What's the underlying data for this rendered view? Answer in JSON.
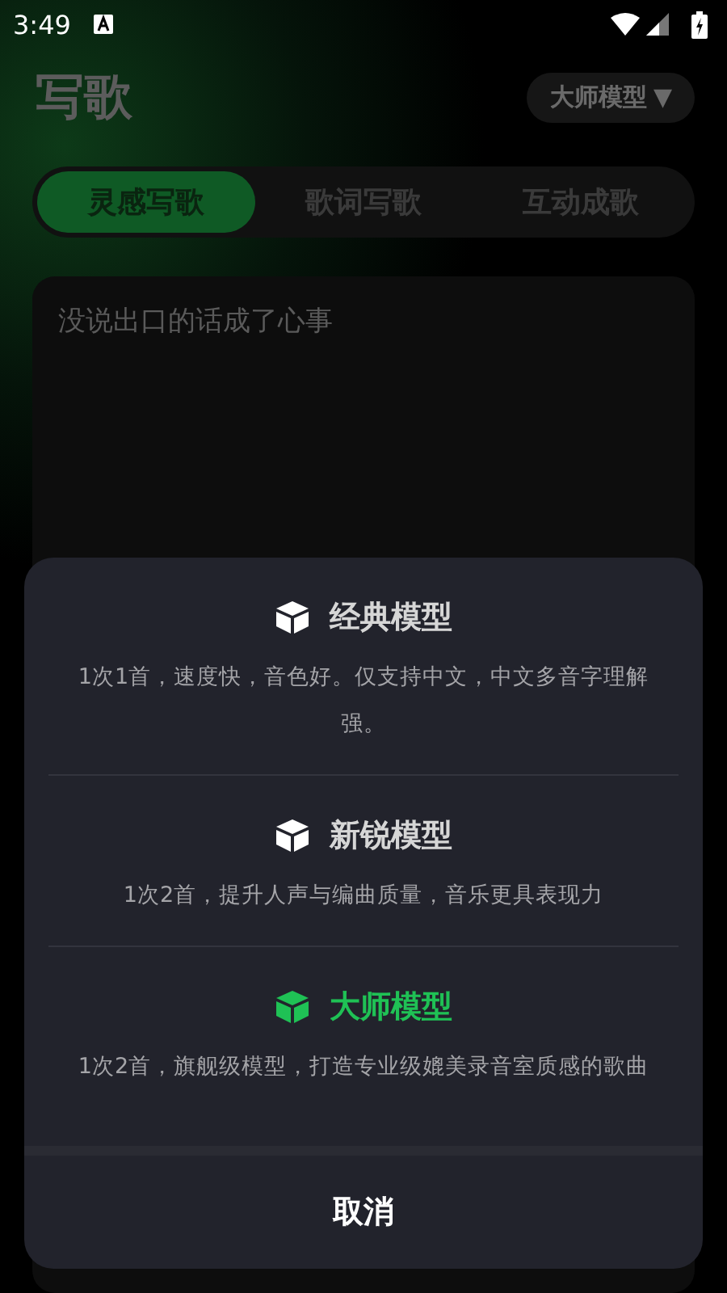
{
  "status_bar": {
    "time": "3:49"
  },
  "header": {
    "title": "写歌",
    "model_picker": {
      "label": "大师模型",
      "caret": "▼"
    }
  },
  "tabs": [
    {
      "label": "灵感写歌",
      "selected": true
    },
    {
      "label": "歌词写歌",
      "selected": false
    },
    {
      "label": "互动成歌",
      "selected": false
    }
  ],
  "prompt": {
    "value": "没说出口的话成了心事"
  },
  "model_sheet": {
    "options": [
      {
        "title": "经典模型",
        "description": "1次1首，速度快，音色好。仅支持中文，中文多音字理解强。",
        "selected": false
      },
      {
        "title": "新锐模型",
        "description": "1次2首，提升人声与编曲质量，音乐更具表现力",
        "selected": false
      },
      {
        "title": "大师模型",
        "description": "1次2首，旗舰级模型，打造专业级媲美录音室质感的歌曲",
        "selected": true
      }
    ],
    "cancel": "取消"
  }
}
